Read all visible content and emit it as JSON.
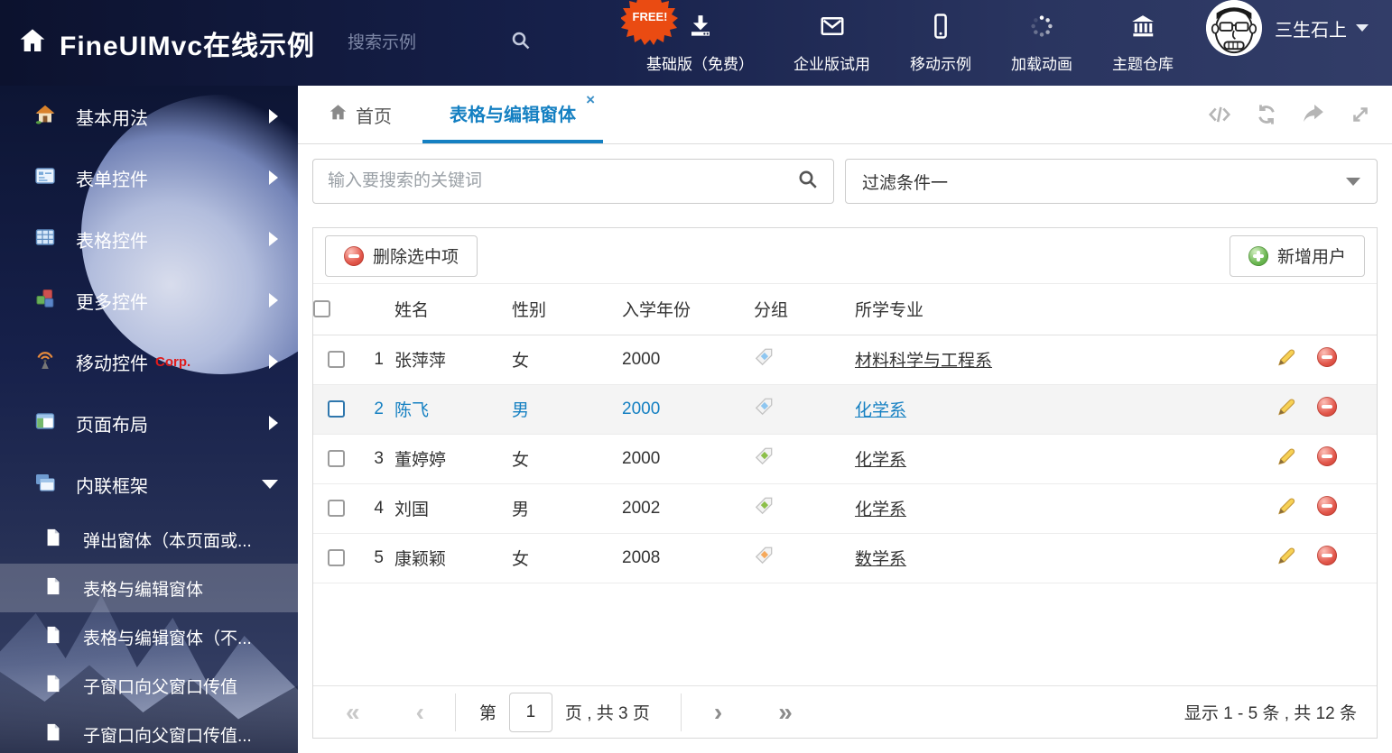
{
  "colors": {
    "accent": "#1580c2",
    "tag_blue": "#8ec6f0",
    "tag_green": "#8cbf4a",
    "tag_orange": "#f5a95c"
  },
  "header": {
    "logo_text": "FineUIMvc在线示例",
    "search_placeholder": "搜索示例",
    "free_badge": "FREE!",
    "nav": [
      {
        "label": "基础版（免费）"
      },
      {
        "label": "企业版试用"
      },
      {
        "label": "移动示例"
      },
      {
        "label": "加载动画"
      },
      {
        "label": "主题仓库"
      }
    ],
    "user_name": "三生石上"
  },
  "sidebar": {
    "items": [
      {
        "label": "基本用法"
      },
      {
        "label": "表单控件"
      },
      {
        "label": "表格控件"
      },
      {
        "label": "更多控件"
      },
      {
        "label": "移动控件",
        "badge": "Corp."
      },
      {
        "label": "页面布局"
      },
      {
        "label": "内联框架"
      }
    ],
    "subitems": [
      {
        "label": "弹出窗体（本页面或...",
        "cls": "sub-item"
      },
      {
        "label": "表格与编辑窗体",
        "cls": "sub-item selected"
      },
      {
        "label": "表格与编辑窗体（不...",
        "cls": "sub-item"
      },
      {
        "label": "子窗口向父窗口传值",
        "cls": "sub-item"
      },
      {
        "label": "子窗口向父窗口传值...",
        "cls": "sub-item"
      }
    ]
  },
  "tabs": {
    "home": "首页",
    "active": "表格与编辑窗体",
    "close": "×"
  },
  "filters": {
    "search_placeholder": "输入要搜索的关键词",
    "filter_value": "过滤条件一"
  },
  "grid": {
    "delete_button": "删除选中项",
    "add_button": "新增用户",
    "columns": {
      "name": "姓名",
      "gender": "性别",
      "year": "入学年份",
      "group": "分组",
      "major": "所学专业"
    },
    "rows": [
      {
        "row_class": "",
        "index": "1",
        "name": "张萍萍",
        "gender": "女",
        "year": "2000",
        "tag_style": "--tag:#8ec6f0",
        "major": "材料科学与工程系"
      },
      {
        "row_class": "selected",
        "index": "2",
        "name": "陈飞",
        "gender": "男",
        "year": "2000",
        "tag_style": "--tag:#8ec6f0",
        "major": "化学系"
      },
      {
        "row_class": "",
        "index": "3",
        "name": "董婷婷",
        "gender": "女",
        "year": "2000",
        "tag_style": "--tag:#8cbf4a",
        "major": "化学系"
      },
      {
        "row_class": "",
        "index": "4",
        "name": "刘国",
        "gender": "男",
        "year": "2002",
        "tag_style": "--tag:#8cbf4a",
        "major": "化学系"
      },
      {
        "row_class": "",
        "index": "5",
        "name": "康颖颖",
        "gender": "女",
        "year": "2008",
        "tag_style": "--tag:#f5a95c",
        "major": "数学系"
      }
    ]
  },
  "pagination": {
    "first": "«",
    "prev": "‹",
    "label_page": "第",
    "page_value": "1",
    "label_total": "页 , 共 3 页",
    "next": "›",
    "last": "»",
    "summary": "显示 1 - 5 条 , 共 12 条"
  }
}
